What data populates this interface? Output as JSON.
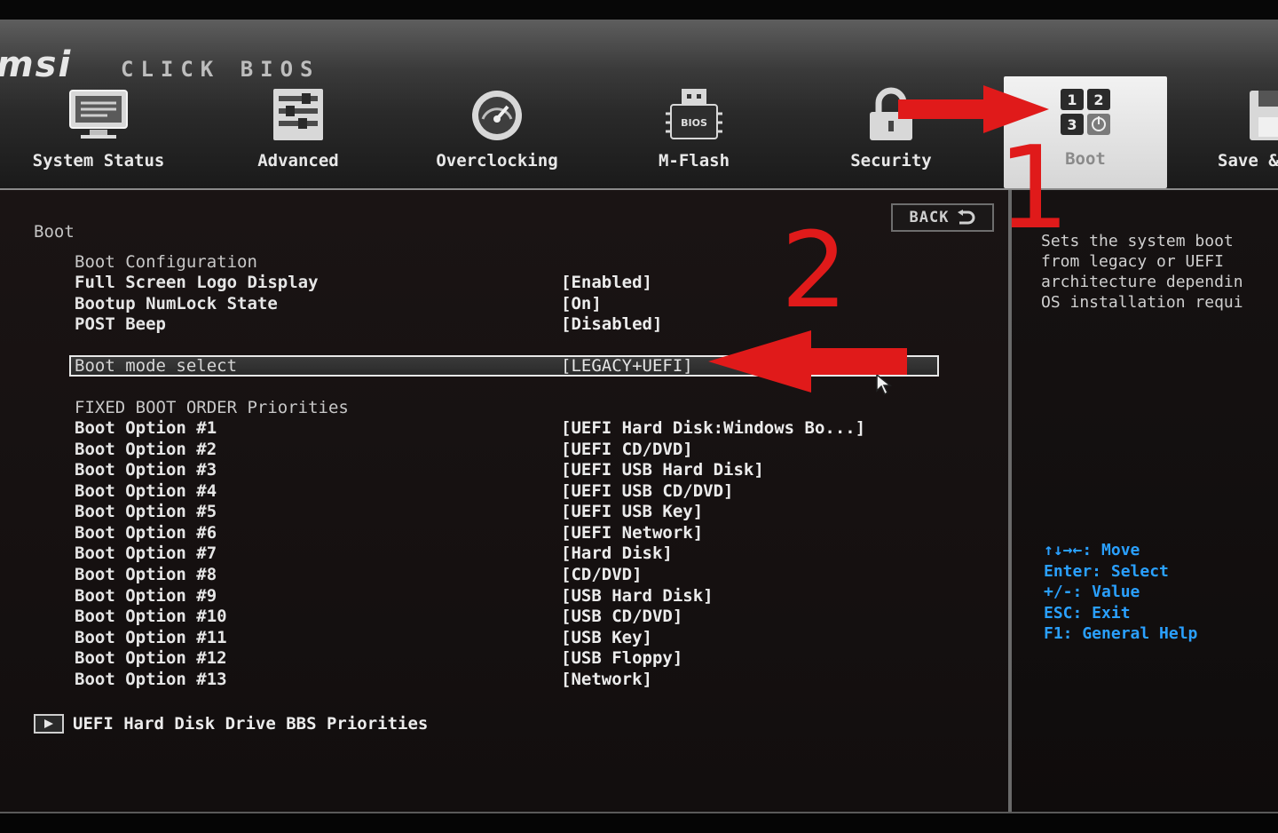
{
  "header": {
    "logo": "msi",
    "logo_sub": "CLICK BIOS",
    "nav": [
      {
        "label": "System Status",
        "icon": "monitor-icon"
      },
      {
        "label": "Advanced",
        "icon": "sliders-icon"
      },
      {
        "label": "Overclocking",
        "icon": "gauge-icon"
      },
      {
        "label": "M-Flash",
        "icon": "usb-bios-icon"
      },
      {
        "label": "Security",
        "icon": "lock-icon"
      },
      {
        "label": "Boot",
        "icon": "boot-order-icon",
        "active": true
      },
      {
        "label": "Save &",
        "icon": "save-icon"
      }
    ]
  },
  "main": {
    "back_label": "BACK",
    "section_title": "Boot",
    "config_header": "Boot Configuration",
    "settings": [
      {
        "label": "Full Screen Logo Display",
        "value": "[Enabled]"
      },
      {
        "label": "Bootup NumLock State",
        "value": "[On]"
      },
      {
        "label": "POST Beep",
        "value": "[Disabled]"
      }
    ],
    "boot_mode": {
      "label": "Boot mode select",
      "value": "[LEGACY+UEFI]"
    },
    "fixed_header": "FIXED BOOT ORDER Priorities",
    "boot_options": [
      {
        "label": "Boot Option #1",
        "value": "[UEFI Hard Disk:Windows Bo...]"
      },
      {
        "label": "Boot Option #2",
        "value": "[UEFI CD/DVD]"
      },
      {
        "label": "Boot Option #3",
        "value": "[UEFI USB Hard Disk]"
      },
      {
        "label": "Boot Option #4",
        "value": "[UEFI USB CD/DVD]"
      },
      {
        "label": "Boot Option #5",
        "value": "[UEFI USB Key]"
      },
      {
        "label": "Boot Option #6",
        "value": "[UEFI Network]"
      },
      {
        "label": "Boot Option #7",
        "value": "[Hard Disk]"
      },
      {
        "label": "Boot Option #8",
        "value": "[CD/DVD]"
      },
      {
        "label": "Boot Option #9",
        "value": "[USB Hard Disk]"
      },
      {
        "label": "Boot Option #10",
        "value": "[USB CD/DVD]"
      },
      {
        "label": "Boot Option #11",
        "value": "[USB Key]"
      },
      {
        "label": "Boot Option #12",
        "value": "[USB Floppy]"
      },
      {
        "label": "Boot Option #13",
        "value": "[Network]"
      }
    ],
    "submenu_label": "UEFI Hard Disk Drive BBS Priorities"
  },
  "help": {
    "text": "Sets the system boot\nfrom legacy or UEFI\narchitecture dependin\nOS installation requi",
    "keys": "↑↓→←: Move\nEnter: Select\n+/-: Value\nESC: Exit\nF1: General Help"
  },
  "annotations": {
    "one": "1",
    "two": "2"
  },
  "colors": {
    "accent_blue": "#2aa0ff",
    "annotation_red": "#e01a1a"
  }
}
